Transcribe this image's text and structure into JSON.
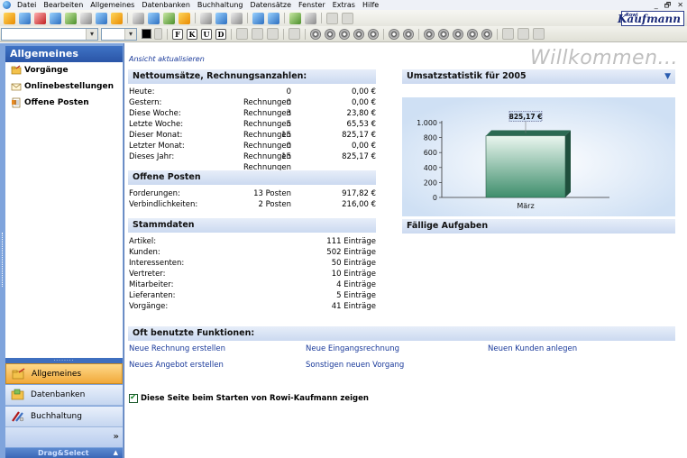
{
  "menubar": {
    "items": [
      "Datei",
      "Bearbeiten",
      "Allgemeines",
      "Datenbanken",
      "Buchhaltung",
      "Datensätze",
      "Fenster",
      "Extras",
      "Hilfe"
    ],
    "window_controls": [
      "_",
      "🗗",
      "✕"
    ]
  },
  "toolbar2": {
    "format_buttons": [
      "F",
      "K",
      "U",
      "D"
    ]
  },
  "logo": {
    "small": "Rowi",
    "big": "Kaufmann"
  },
  "sidebar": {
    "header": "Allgemeines",
    "items": [
      {
        "label": "Vorgänge",
        "icon": "folder-icon"
      },
      {
        "label": "Onlinebestellungen",
        "icon": "envelope-icon"
      },
      {
        "label": "Offene Posten",
        "icon": "invoice-icon"
      }
    ],
    "grip": "........",
    "nav_buttons": [
      {
        "label": "Allgemeines",
        "active": true
      },
      {
        "label": "Datenbanken",
        "active": false
      },
      {
        "label": "Buchhaltung",
        "active": false
      }
    ],
    "more": "»",
    "drag_select": "Drag&Select",
    "drag_arrow": "▲"
  },
  "main": {
    "refresh_link": "Ansicht aktualisieren",
    "welcome": "Willkommen...",
    "umsatz": {
      "title": "Nettoumsätze, Rechnungsanzahlen:",
      "rows": [
        {
          "label": "Heute:",
          "count": "0 Rechnungen",
          "amount": "0,00 €"
        },
        {
          "label": "Gestern:",
          "count": "0 Rechnungen",
          "amount": "0,00 €"
        },
        {
          "label": "Diese Woche:",
          "count": "3 Rechnungen",
          "amount": "23,80 €"
        },
        {
          "label": "Letzte Woche:",
          "count": "5 Rechnungen",
          "amount": "65,53 €"
        },
        {
          "label": "Dieser Monat:",
          "count": "15 Rechnungen",
          "amount": "825,17 €"
        },
        {
          "label": "Letzter Monat:",
          "count": "0 Rechnungen",
          "amount": "0,00 €"
        },
        {
          "label": "Dieses Jahr:",
          "count": "15 Rechnungen",
          "amount": "825,17 €"
        }
      ]
    },
    "offene": {
      "title": "Offene Posten",
      "rows": [
        {
          "label": "Forderungen:",
          "count": "13 Posten",
          "amount": "917,82 €"
        },
        {
          "label": "Verbindlichkeiten:",
          "count": "2 Posten",
          "amount": "216,00 €"
        }
      ]
    },
    "stamm": {
      "title": "Stammdaten",
      "rows": [
        {
          "label": "Artikel:",
          "value": "111 Einträge"
        },
        {
          "label": "Kunden:",
          "value": "502 Einträge"
        },
        {
          "label": "Interessenten:",
          "value": "50 Einträge"
        },
        {
          "label": "Vertreter:",
          "value": "10 Einträge"
        },
        {
          "label": "Mitarbeiter:",
          "value": "4 Einträge"
        },
        {
          "label": "Lieferanten:",
          "value": "5 Einträge"
        },
        {
          "label": "Vorgänge:",
          "value": "41 Einträge"
        }
      ]
    },
    "stats_title": "Umsatzstatistik für 2005",
    "stats_dropdown": "▼",
    "tasks_title": "Fällige Aufgaben",
    "functions": {
      "title": "Oft benutzte Funktionen:",
      "links": [
        "Neue Rechnung erstellen",
        "Neue Eingangsrechnung",
        "Neuen Kunden anlegen",
        "Neues Angebot erstellen",
        "Sonstigen neuen Vorgang"
      ]
    },
    "startup_checkbox": {
      "label": "Diese Seite beim Starten von Rowi-Kaufmann zeigen",
      "checked": true
    }
  },
  "chart_data": {
    "type": "bar",
    "title": "Umsatzstatistik für 2005",
    "categories": [
      "März"
    ],
    "values": [
      825.17
    ],
    "data_labels": [
      "825,17 €"
    ],
    "yticks": [
      0,
      200,
      400,
      600,
      800,
      1000
    ],
    "ytick_labels": [
      "0",
      "200",
      "400",
      "600",
      "800",
      "1.000"
    ],
    "ylim": [
      0,
      1000
    ],
    "bar_color": "#4a9a7a"
  }
}
